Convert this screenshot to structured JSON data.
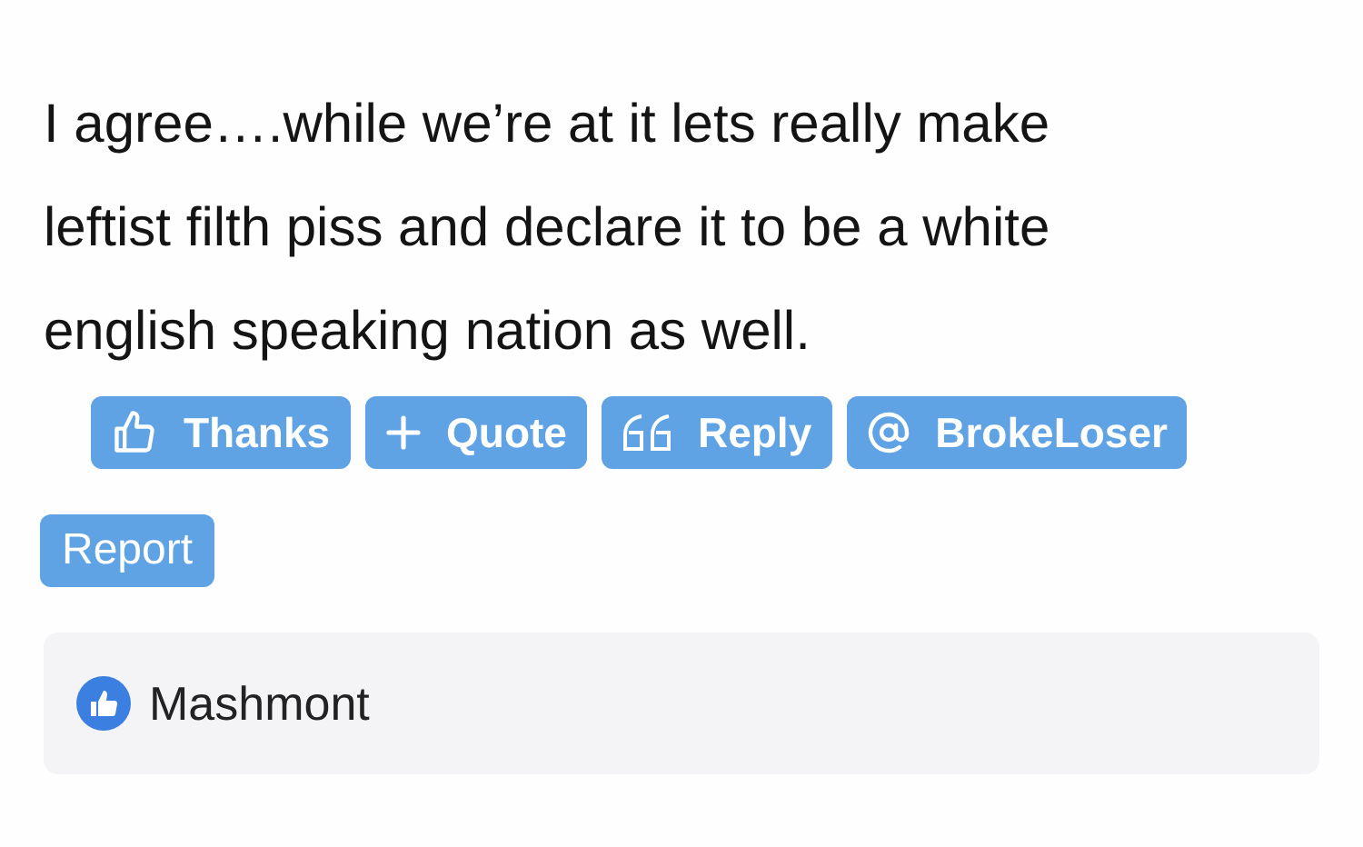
{
  "post": {
    "body": "I agree….while we’re at it lets really make leftist filth piss and declare it to be a white english speaking nation as well."
  },
  "actions": [
    {
      "label": "Thanks",
      "kind": "thumbs"
    },
    {
      "label": "Quote",
      "kind": "plus"
    },
    {
      "label": "Reply",
      "kind": "quote"
    },
    {
      "label": "BrokeLoser",
      "kind": "mention"
    },
    {
      "label": "Report",
      "kind": "plain"
    }
  ],
  "reactions": {
    "users": [
      "Mashmont"
    ]
  }
}
